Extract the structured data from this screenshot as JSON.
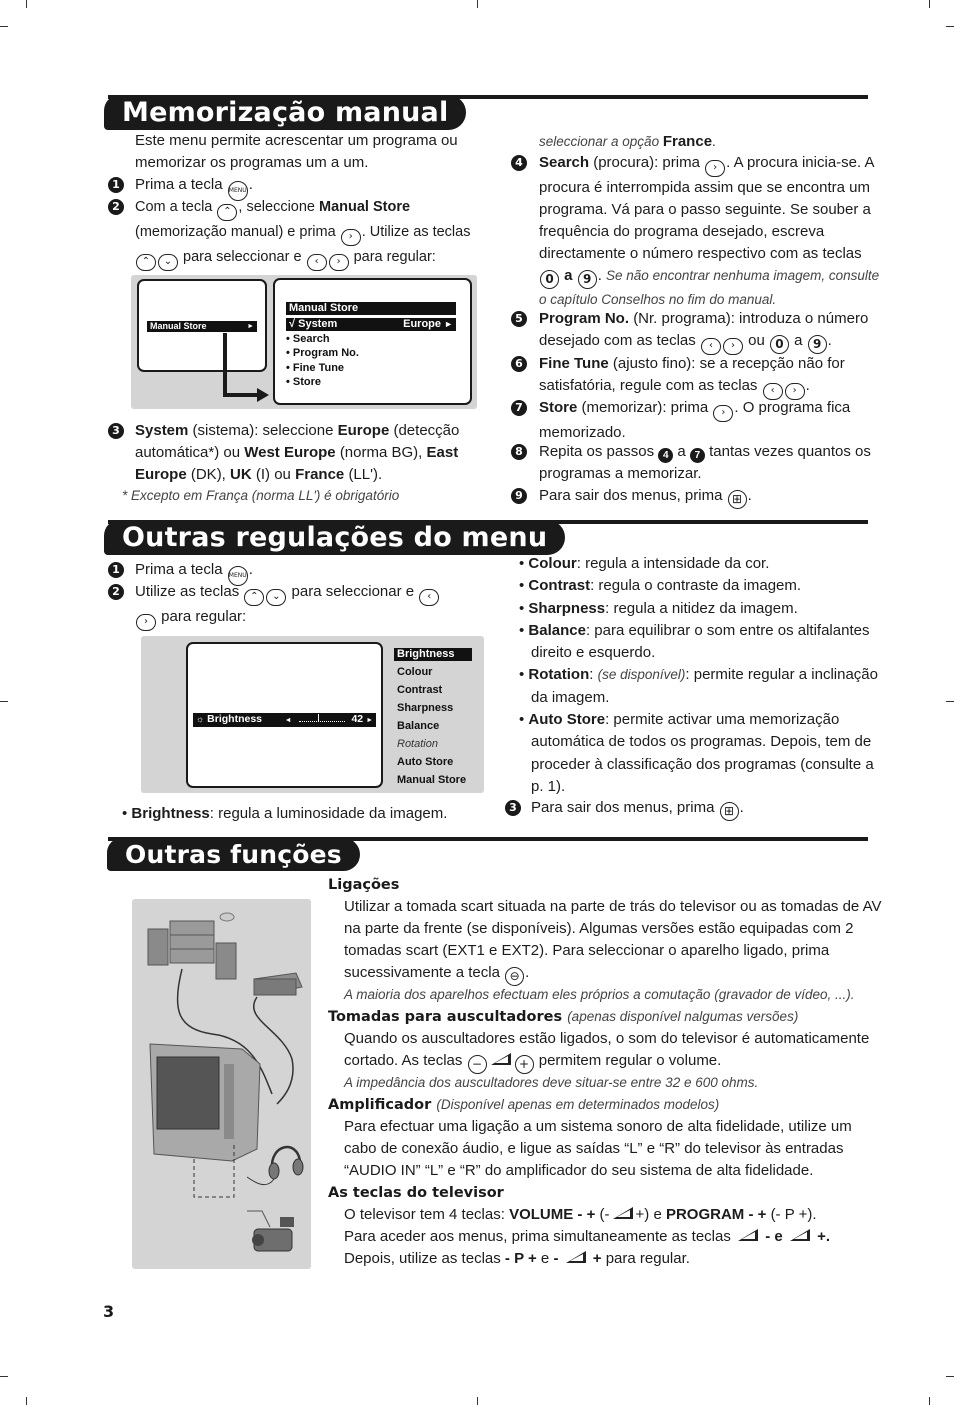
{
  "page_number": "3",
  "sections": {
    "manual_store": {
      "title": "Memorização manual",
      "intro": "Este menu permite acrescentar um programa ou memorizar os programas um a um.",
      "steps": [
        {
          "n": "1",
          "text": "Prima a tecla",
          "key": "MENU"
        },
        {
          "n": "2",
          "parts": [
            "Com a tecla",
            ", seleccione",
            "Manual Store",
            "(memorização manual) e prima",
            ". Utilize as teclas",
            "para seleccionar e",
            "para regular:"
          ]
        },
        {
          "n": "3",
          "label": "System",
          "parts": [
            "(sistema): seleccione",
            "Europe",
            "(detecção automática*) ou",
            "West Europe",
            "(norma BG),",
            "East Europe",
            "(DK),",
            "UK",
            "(I) ou",
            "France",
            "(LL')."
          ]
        },
        {
          "n": "4",
          "label": "Search",
          "parts": [
            "(procura): prima",
            ". A procura inicia-se. A procura é interrompida assim que se encontra um programa. Vá para o passo seguinte. Se souber a frequência do programa desejado, escreva directamente o número respectivo com as teclas",
            "a",
            ".",
            "Se não encontrar nenhuma imagem, consulte o capítulo Conselhos no fim do manual."
          ]
        },
        {
          "n": "5",
          "label": "Program No.",
          "parts": [
            "(Nr. programa): introduza o número desejado com as teclas",
            "ou",
            "a",
            "."
          ]
        },
        {
          "n": "6",
          "label": "Fine Tune",
          "parts": [
            "(ajusto fino): se a recepção não for satisfatória, regule com as teclas",
            "."
          ]
        },
        {
          "n": "7",
          "label": "Store",
          "parts": [
            "(memorizar): prima",
            ". O programa fica memorizado."
          ]
        },
        {
          "n": "8",
          "parts": [
            "Repita os passos",
            "a",
            "tantas vezes quantos os programas a memorizar."
          ],
          "refs": [
            "4",
            "7"
          ]
        },
        {
          "n": "9",
          "text": "Para sair dos menus, prima"
        }
      ],
      "footnote": "* Excepto em França (norma LL') é obrigatório",
      "footnote_cont": "seleccionar a opção",
      "footnote_bold": "France",
      "osd_left": {
        "item": "Manual Store",
        "arrow": "►"
      },
      "osd_right": {
        "title": "Manual Store",
        "selected": {
          "check": "√",
          "label": "System",
          "value": "Europe",
          "arrow": "►"
        },
        "items": [
          "• Search",
          "• Program No.",
          "• Fine Tune",
          "• Store"
        ]
      }
    },
    "other_settings": {
      "title": "Outras regulações do menu",
      "steps": [
        {
          "n": "1",
          "text": "Prima a tecla",
          "key": "MENU"
        },
        {
          "n": "2",
          "parts": [
            "Utilize as teclas",
            "para seleccionar e",
            "para regular:"
          ]
        },
        {
          "n": "3",
          "text": "Para sair dos menus, prima"
        }
      ],
      "osd_slider": {
        "label": "Brightness",
        "value": "42",
        "level": 0.42,
        "left_arrow": "◄",
        "right_arrow": "►"
      },
      "osd_menu": {
        "selected": "Brightness",
        "items": [
          "Colour",
          "Contrast",
          "Sharpness",
          "Balance",
          "Rotation",
          "Auto Store",
          "Manual Store"
        ],
        "italic_item": "Rotation"
      },
      "bullets": [
        {
          "label": "Brightness",
          "text": ": regula a luminosidade da imagem."
        },
        {
          "label": "Colour",
          "text": ": regula a intensidade da cor."
        },
        {
          "label": "Contrast",
          "text": ": regula o contraste da imagem."
        },
        {
          "label": "Sharpness",
          "text": ": regula a nitidez da imagem."
        },
        {
          "label": "Balance",
          "text": ": para equilibrar o som entre os altifalantes direito e esquerdo."
        },
        {
          "label": "Rotation",
          "note": "(se disponível)",
          "text": ": permite regular a inclinação da imagem."
        },
        {
          "label": "Auto Store",
          "text": ": permite activar uma memorização automática de todos os programas. Depois, tem de proceder à classificação dos programas (consulte a p. 1)."
        }
      ]
    },
    "other_functions": {
      "title": "Outras funções",
      "blocks": [
        {
          "heading": "Ligações",
          "body": "Utilizar a tomada scart situada na parte de trás do televisor ou as tomadas de AV na parte da frente (se disponíveis). Algumas versões estão equipadas com 2 tomadas scart (EXT1 e EXT2). Para seleccionar o aparelho ligado, prima sucessivamente a tecla",
          "note": "A maioria dos aparelhos efectuam eles próprios a comutação (gravador de vídeo, ...)."
        },
        {
          "heading": "Tomadas para auscultadores",
          "heading_note": "(apenas disponível nalgumas versões)",
          "body_1": "Quando os auscultadores estão ligados, o som do televisor é automaticamente cortado. As teclas",
          "body_2": "permitem regular o volume.",
          "note": "A impedância dos auscultadores deve situar-se entre 32 e 600 ohms."
        },
        {
          "heading": "Amplificador",
          "heading_note": "(Disponível apenas em determinados modelos)",
          "body": "Para efectuar uma ligação a um sistema sonoro de alta fidelidade, utilize um cabo de conexão áudio, e ligue as saídas “L” e “R” do televisor às entradas “AUDIO IN” “L” e “R” do amplificador do seu sistema de alta fidelidade."
        },
        {
          "heading": "As teclas do televisor",
          "line1_a": "O televisor tem 4 teclas:",
          "line1_vol": "VOLUME - +",
          "line1_b": "(-",
          "line1_c": "+) e",
          "line1_prog": "PROGRAM - +",
          "line1_d": "(- P +).",
          "line2_a": "Para aceder aos menus, prima simultaneamente as teclas",
          "line2_b": "- e",
          "line2_c": "+.",
          "line3_a": "Depois, utilize as teclas",
          "line3_p": "- P +",
          "line3_b": "e",
          "line3_c": "- ",
          "line3_d": "+",
          "line3_e": "para regular."
        }
      ],
      "illustration": {
        "subjects": [
          "hifi-system",
          "cd",
          "decoder-box",
          "television",
          "headphones",
          "camcorder"
        ]
      }
    }
  },
  "keys": {
    "menu": "MENU",
    "up": "⌃",
    "down": "⌄",
    "left": "‹",
    "right": "›",
    "zero": "0",
    "nine": "9",
    "exit": "⊞",
    "av": "⊖",
    "minus": "−",
    "plus": "+"
  }
}
